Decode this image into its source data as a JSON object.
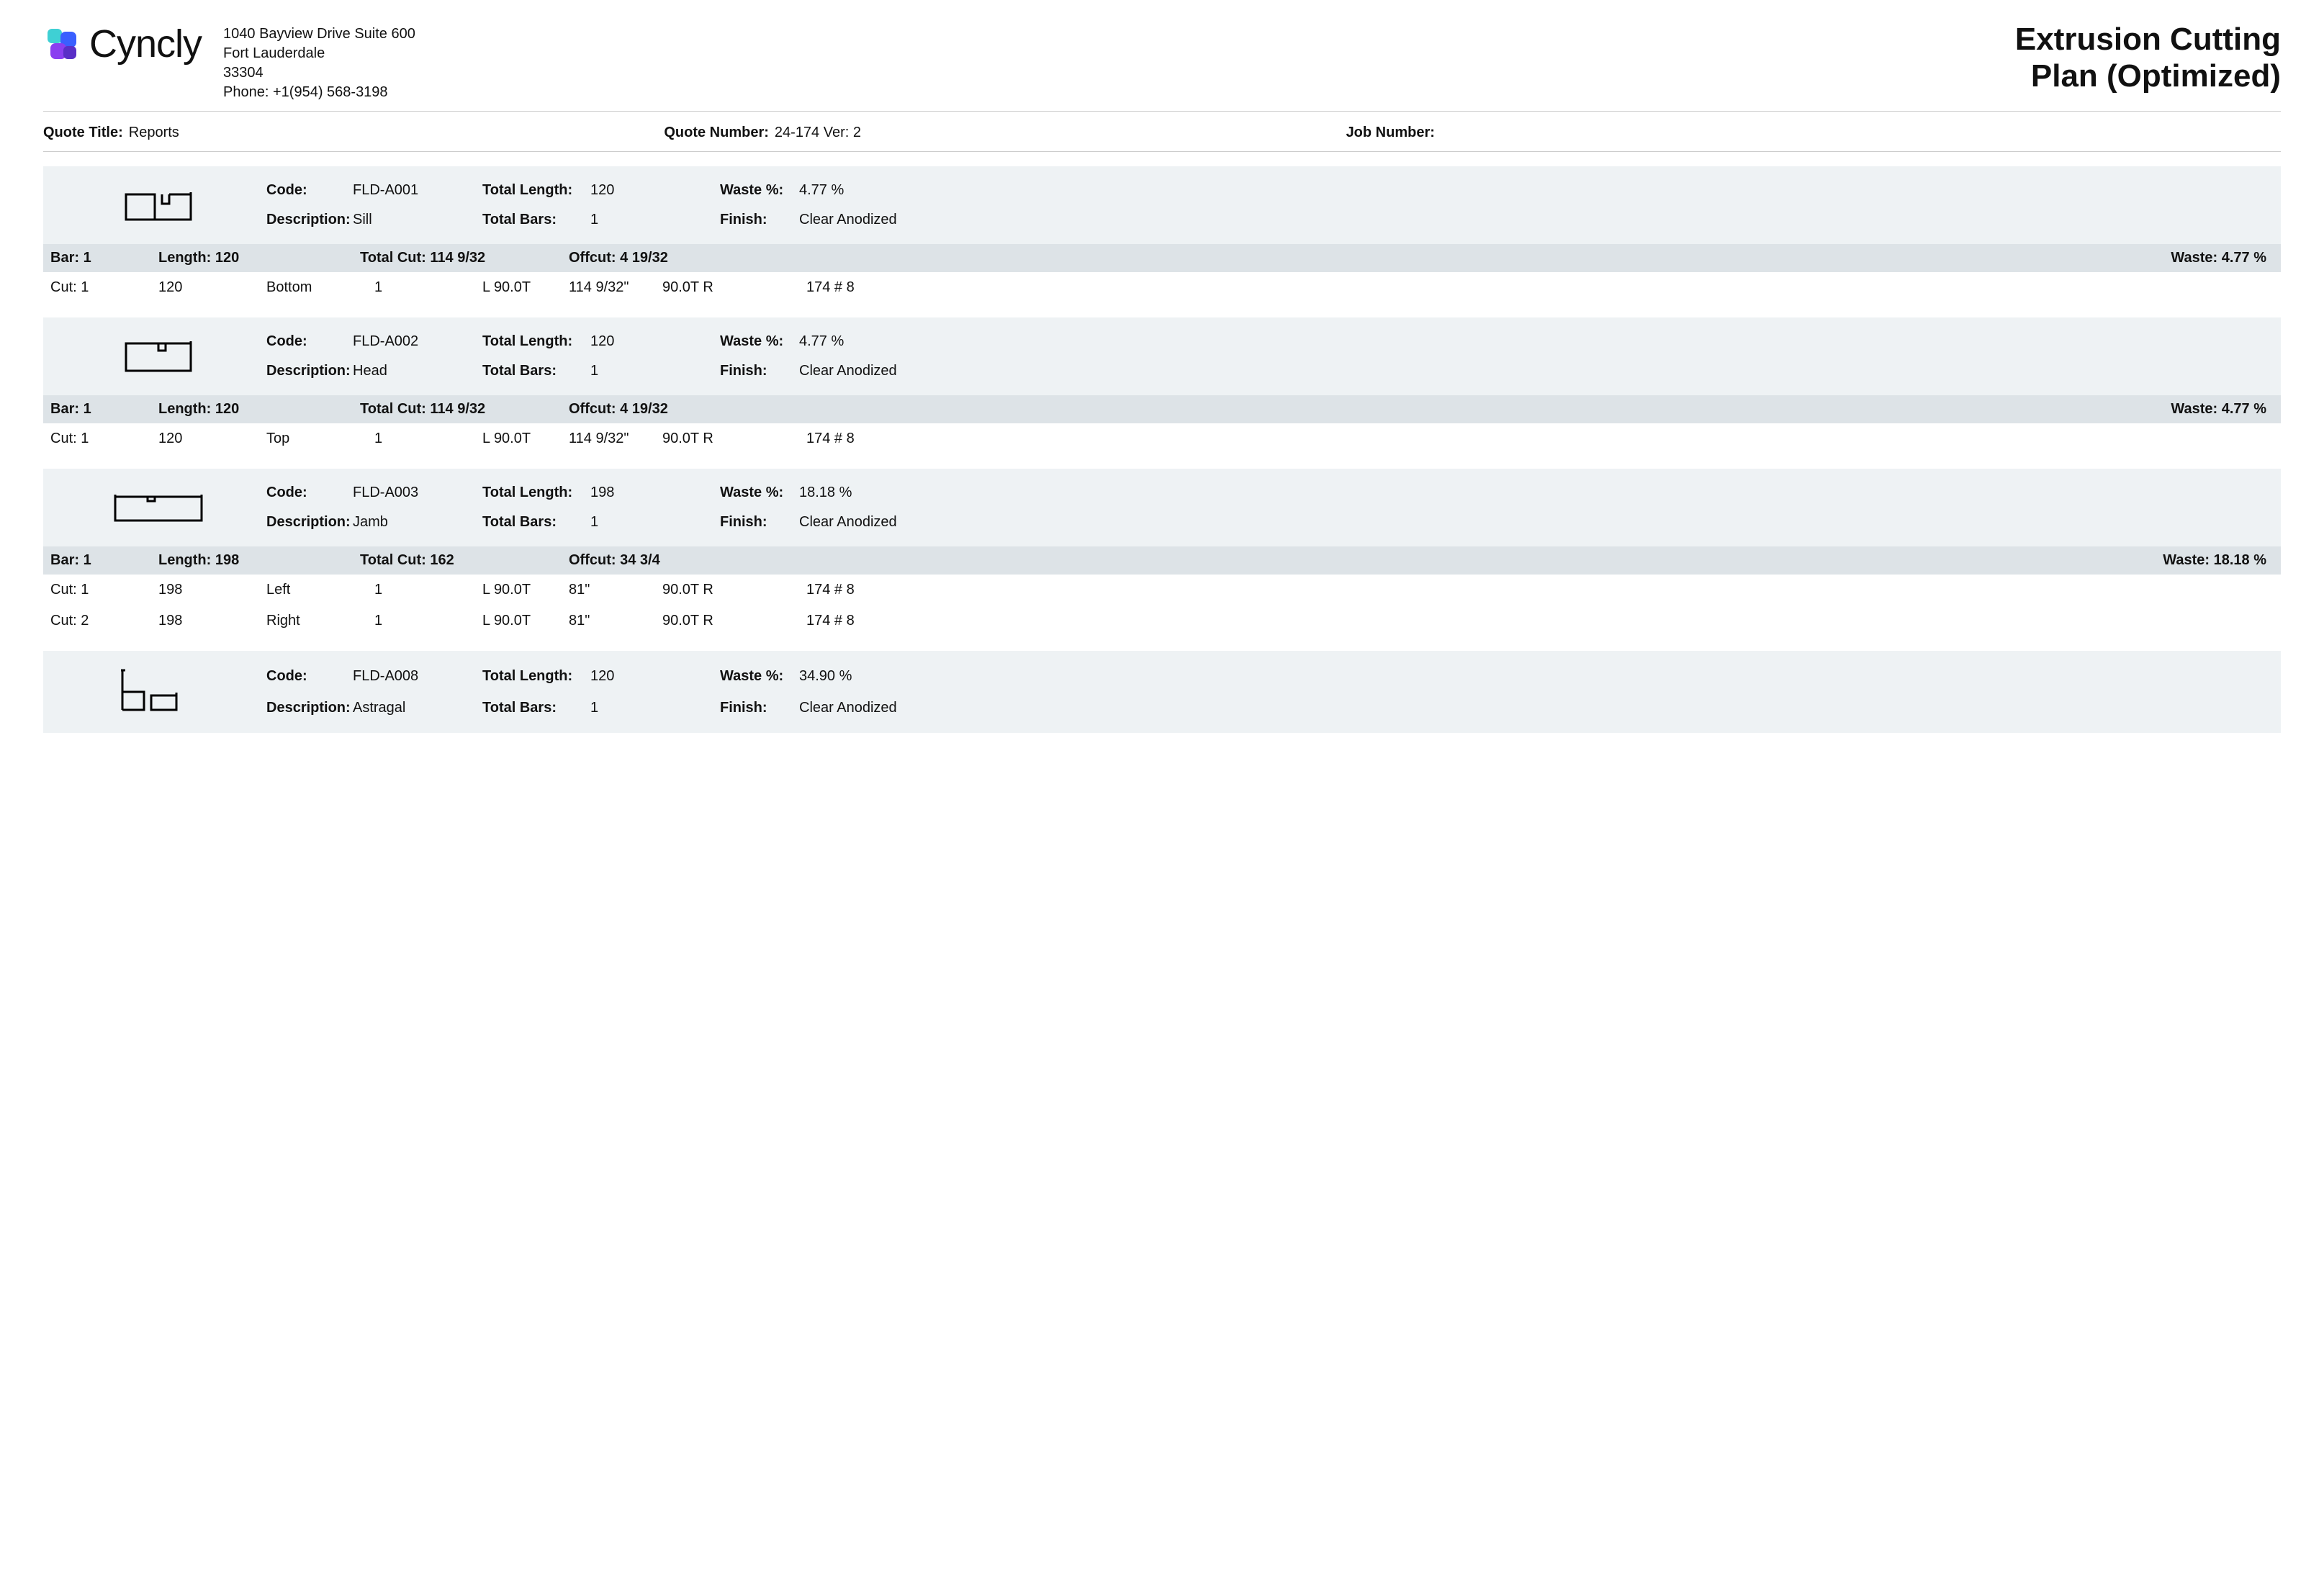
{
  "company": {
    "name": "Cyncly",
    "address_line1": "1040 Bayview Drive Suite 600",
    "address_line2": "Fort Lauderdale",
    "postal": "33304",
    "phone_label": "Phone:",
    "phone": "+1(954) 568-3198"
  },
  "report": {
    "title_line1": "Extrusion Cutting",
    "title_line2": "Plan (Optimized)"
  },
  "meta": {
    "quote_title_label": "Quote Title:",
    "quote_title": "Reports",
    "quote_number_label": "Quote Number:",
    "quote_number": "24-174 Ver: 2",
    "job_number_label": "Job Number:",
    "job_number": ""
  },
  "labels": {
    "code": "Code:",
    "description": "Description:",
    "total_length": "Total Length:",
    "total_bars": "Total Bars:",
    "waste_pct": "Waste %:",
    "finish": "Finish:",
    "bar": "Bar:",
    "length": "Length:",
    "total_cut": "Total Cut:",
    "offcut": "Offcut:",
    "waste": "Waste:",
    "cut": "Cut:"
  },
  "sections": [
    {
      "code": "FLD-A001",
      "description": "Sill",
      "total_length": "120",
      "total_bars": "1",
      "waste_pct": "4.77 %",
      "finish": "Clear Anodized",
      "bar": {
        "num": "1",
        "length": "120",
        "total_cut": "114 9/32",
        "offcut": "4 19/32",
        "waste": "4.77 %"
      },
      "cuts": [
        {
          "num": "1",
          "len": "120",
          "pos": "Bottom",
          "qty": "1",
          "left": "L  90.0T",
          "size": "114 9/32\"",
          "right": "90.0T  R",
          "ref": "174  # 8"
        }
      ]
    },
    {
      "code": "FLD-A002",
      "description": "Head",
      "total_length": "120",
      "total_bars": "1",
      "waste_pct": "4.77 %",
      "finish": "Clear Anodized",
      "bar": {
        "num": "1",
        "length": "120",
        "total_cut": "114 9/32",
        "offcut": "4 19/32",
        "waste": "4.77 %"
      },
      "cuts": [
        {
          "num": "1",
          "len": "120",
          "pos": "Top",
          "qty": "1",
          "left": "L  90.0T",
          "size": "114 9/32\"",
          "right": "90.0T  R",
          "ref": "174  # 8"
        }
      ]
    },
    {
      "code": "FLD-A003",
      "description": "Jamb",
      "total_length": "198",
      "total_bars": "1",
      "waste_pct": "18.18 %",
      "finish": "Clear Anodized",
      "bar": {
        "num": "1",
        "length": "198",
        "total_cut": "162",
        "offcut": "34 3/4",
        "waste": "18.18 %"
      },
      "cuts": [
        {
          "num": "1",
          "len": "198",
          "pos": "Left",
          "qty": "1",
          "left": "L  90.0T",
          "size": "81\"",
          "right": "90.0T  R",
          "ref": "174  # 8"
        },
        {
          "num": "2",
          "len": "198",
          "pos": "Right",
          "qty": "1",
          "left": "L  90.0T",
          "size": "81\"",
          "right": "90.0T  R",
          "ref": "174  # 8"
        }
      ]
    },
    {
      "code": "FLD-A008",
      "description": "Astragal",
      "total_length": "120",
      "total_bars": "1",
      "waste_pct": "34.90 %",
      "finish": "Clear Anodized",
      "bar": null,
      "cuts": []
    }
  ]
}
